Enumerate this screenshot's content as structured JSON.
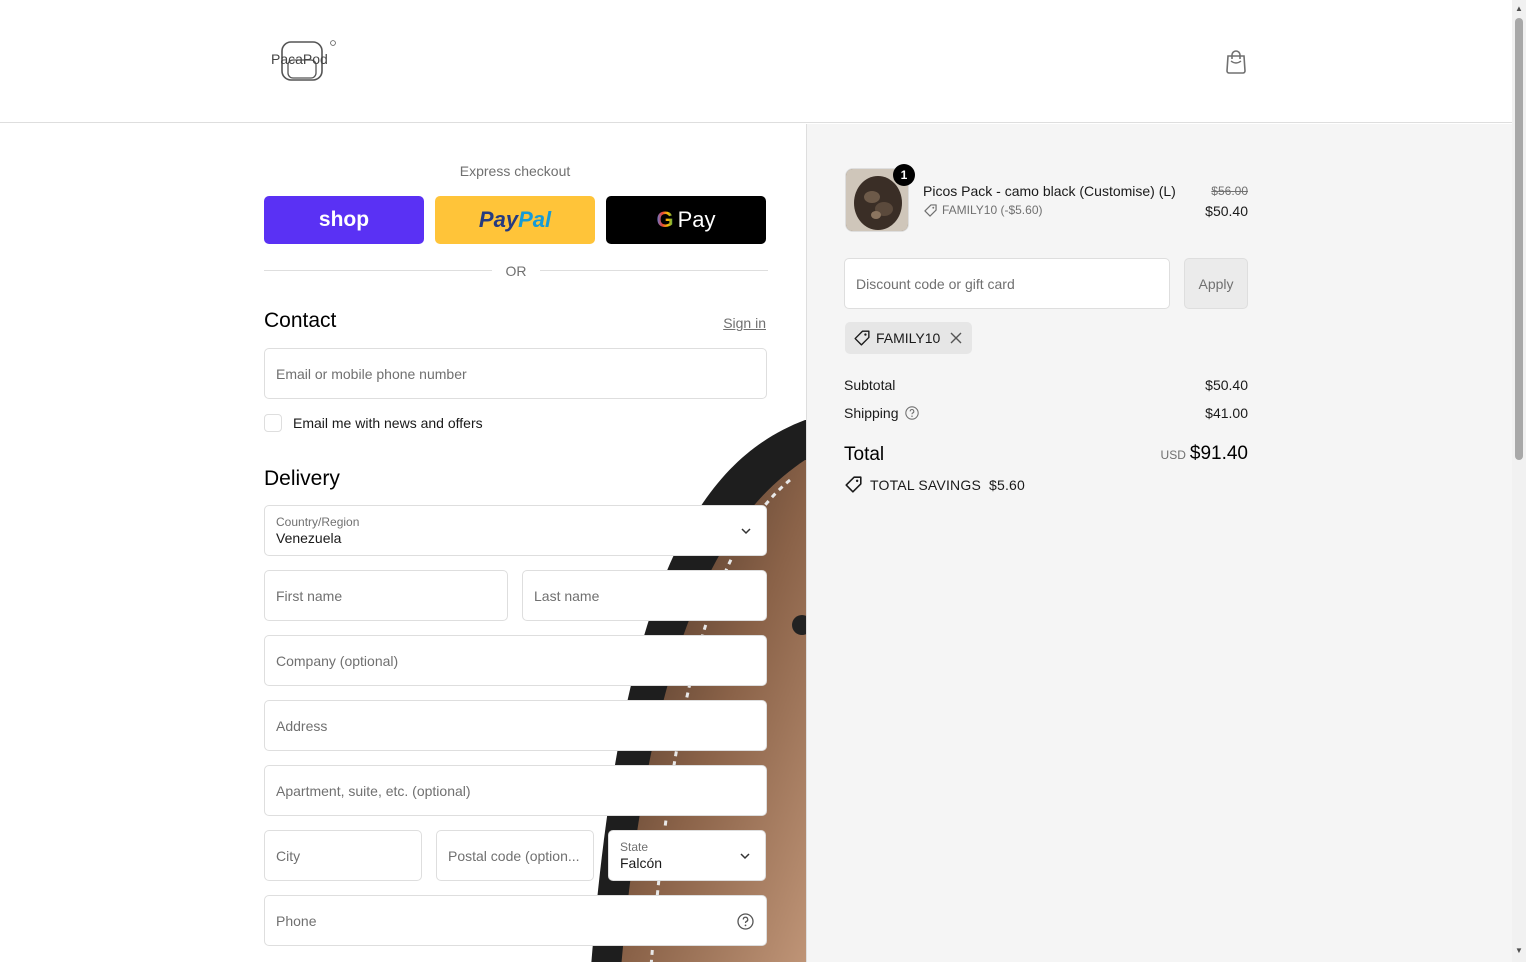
{
  "header": {
    "brand": "PacaPod"
  },
  "express": {
    "label": "Express checkout",
    "shop": "shop",
    "paypal_a": "Pay",
    "paypal_b": "Pal",
    "gpay_g": "G",
    "gpay_label": "Pay"
  },
  "or_label": "OR",
  "contact": {
    "title": "Contact",
    "sign_in": "Sign in",
    "email_placeholder": "Email or mobile phone number",
    "newsletter": "Email me with news and offers"
  },
  "delivery": {
    "title": "Delivery",
    "country_label": "Country/Region",
    "country_value": "Venezuela",
    "first_name": "First name",
    "last_name": "Last name",
    "company": "Company (optional)",
    "address": "Address",
    "apartment": "Apartment, suite, etc. (optional)",
    "city": "City",
    "postal": "Postal code (option...",
    "state_label": "State",
    "state_value": "Falcón",
    "phone": "Phone"
  },
  "order": {
    "quantity": "1",
    "product_name": "Picos Pack - camo black (Customise) (L)",
    "product_discount": "FAMILY10 (-$5.60)",
    "price_old": "$56.00",
    "price_new": "$50.40",
    "discount_placeholder": "Discount code or gift card",
    "apply": "Apply",
    "applied_code": "FAMILY10",
    "subtotal_label": "Subtotal",
    "subtotal_value": "$50.40",
    "shipping_label": "Shipping",
    "shipping_value": "$41.00",
    "total_label": "Total",
    "currency": "USD",
    "total_value": "$91.40",
    "savings_label": "TOTAL SAVINGS",
    "savings_value": "$5.60"
  },
  "colors": {
    "shop": "#5a31f4",
    "paypal": "#ffc439",
    "gpay": "#000000",
    "summary_bg": "#f5f5f5"
  }
}
